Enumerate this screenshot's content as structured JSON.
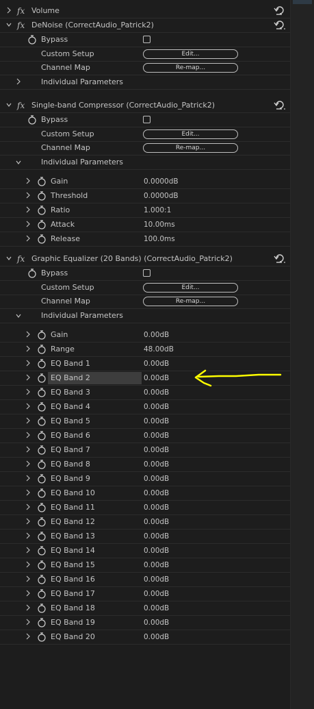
{
  "volume": {
    "title": "Volume"
  },
  "denoise": {
    "title": "DeNoise (CorrectAudio_Patrick2)",
    "bypass": "Bypass",
    "custom_setup": "Custom Setup",
    "edit_label": "Edit...",
    "channel_map": "Channel Map",
    "remap_label": "Re-map...",
    "individual": "Individual Parameters"
  },
  "compressor": {
    "title": "Single-band Compressor (CorrectAudio_Patrick2)",
    "bypass": "Bypass",
    "custom_setup": "Custom Setup",
    "edit_label": "Edit...",
    "channel_map": "Channel Map",
    "remap_label": "Re-map...",
    "individual": "Individual Parameters",
    "params": [
      {
        "name": "Gain",
        "value": "0.0000dB"
      },
      {
        "name": "Threshold",
        "value": "0.0000dB"
      },
      {
        "name": "Ratio",
        "value": "1.000:1"
      },
      {
        "name": "Attack",
        "value": "10.00ms"
      },
      {
        "name": "Release",
        "value": "100.0ms"
      }
    ]
  },
  "equalizer": {
    "title": "Graphic Equalizer (20 Bands) (CorrectAudio_Patrick2)",
    "bypass": "Bypass",
    "custom_setup": "Custom Setup",
    "edit_label": "Edit...",
    "channel_map": "Channel Map",
    "remap_label": "Re-map...",
    "individual": "Individual Parameters",
    "params": [
      {
        "name": "Gain",
        "value": "0.00dB"
      },
      {
        "name": "Range",
        "value": "48.00dB"
      },
      {
        "name": "EQ Band 1",
        "value": "0.00dB"
      },
      {
        "name": "EQ Band 2",
        "value": "0.00dB"
      },
      {
        "name": "EQ Band 3",
        "value": "0.00dB"
      },
      {
        "name": "EQ Band 4",
        "value": "0.00dB"
      },
      {
        "name": "EQ Band 5",
        "value": "0.00dB"
      },
      {
        "name": "EQ Band 6",
        "value": "0.00dB"
      },
      {
        "name": "EQ Band 7",
        "value": "0.00dB"
      },
      {
        "name": "EQ Band 8",
        "value": "0.00dB"
      },
      {
        "name": "EQ Band 9",
        "value": "0.00dB"
      },
      {
        "name": "EQ Band 10",
        "value": "0.00dB"
      },
      {
        "name": "EQ Band 11",
        "value": "0.00dB"
      },
      {
        "name": "EQ Band 12",
        "value": "0.00dB"
      },
      {
        "name": "EQ Band 13",
        "value": "0.00dB"
      },
      {
        "name": "EQ Band 14",
        "value": "0.00dB"
      },
      {
        "name": "EQ Band 15",
        "value": "0.00dB"
      },
      {
        "name": "EQ Band 16",
        "value": "0.00dB"
      },
      {
        "name": "EQ Band 17",
        "value": "0.00dB"
      },
      {
        "name": "EQ Band 18",
        "value": "0.00dB"
      },
      {
        "name": "EQ Band 19",
        "value": "0.00dB"
      },
      {
        "name": "EQ Band 20",
        "value": "0.00dB"
      }
    ],
    "selected_param": "EQ Band 2"
  },
  "icons": {
    "fx": "fx",
    "chevron_right": "chevron-right-icon",
    "chevron_down": "chevron-down-icon",
    "stopwatch": "stopwatch-icon",
    "reset": "reset-icon"
  },
  "colors": {
    "panel_bg": "#1d1d1d",
    "text": "#c4c4c4",
    "selection": "#3d3d3d",
    "annotation_arrow": "#ffff00"
  }
}
